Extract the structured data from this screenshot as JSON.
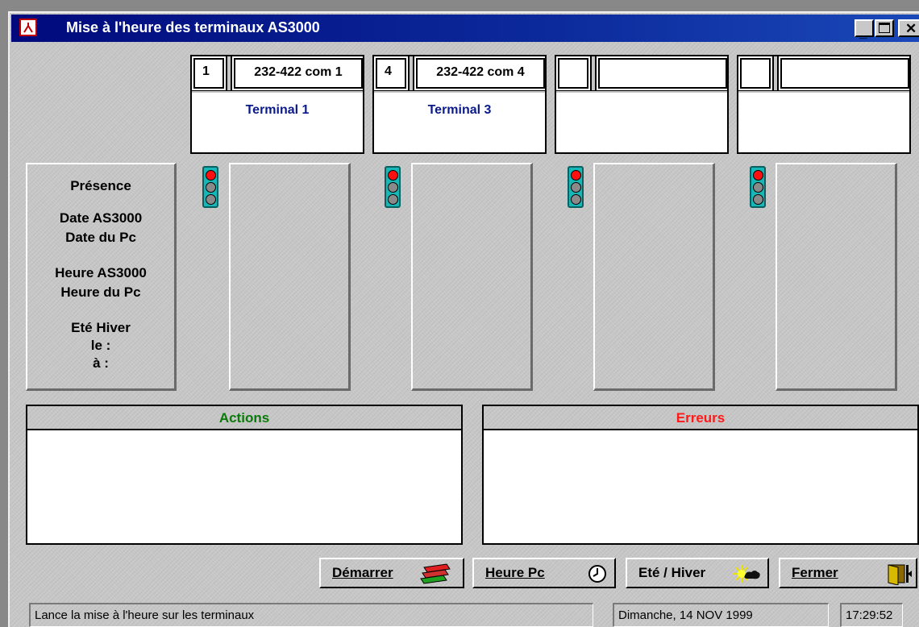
{
  "window": {
    "title": "Mise à l'heure des terminaux AS3000"
  },
  "terminals": [
    {
      "number": "1",
      "port": "232-422 com 1",
      "name": "Terminal 1"
    },
    {
      "number": "4",
      "port": "232-422 com 4",
      "name": "Terminal 3"
    },
    {
      "number": "",
      "port": "",
      "name": ""
    },
    {
      "number": "",
      "port": "",
      "name": ""
    }
  ],
  "row_labels": {
    "presence": "Présence",
    "date_as3000": "Date AS3000",
    "date_pc": "Date du Pc",
    "heure_as3000": "Heure AS3000",
    "heure_pc": "Heure du Pc",
    "ete_hiver": "Eté Hiver",
    "le": "le :",
    "a": "à :"
  },
  "actions": {
    "header": "Actions",
    "header_color": "#0a7a0a"
  },
  "erreurs": {
    "header": "Erreurs",
    "header_color": "#ff1a1a"
  },
  "buttons": {
    "demarrer": "Démarrer",
    "heure_pc": "Heure Pc",
    "ete_hiver": "Eté / Hiver",
    "fermer": "Fermer"
  },
  "statusbar": {
    "message": "Lance la mise à l'heure sur les terminaux",
    "date": "Dimanche, 14 NOV 1999",
    "time": "17:29:52"
  }
}
